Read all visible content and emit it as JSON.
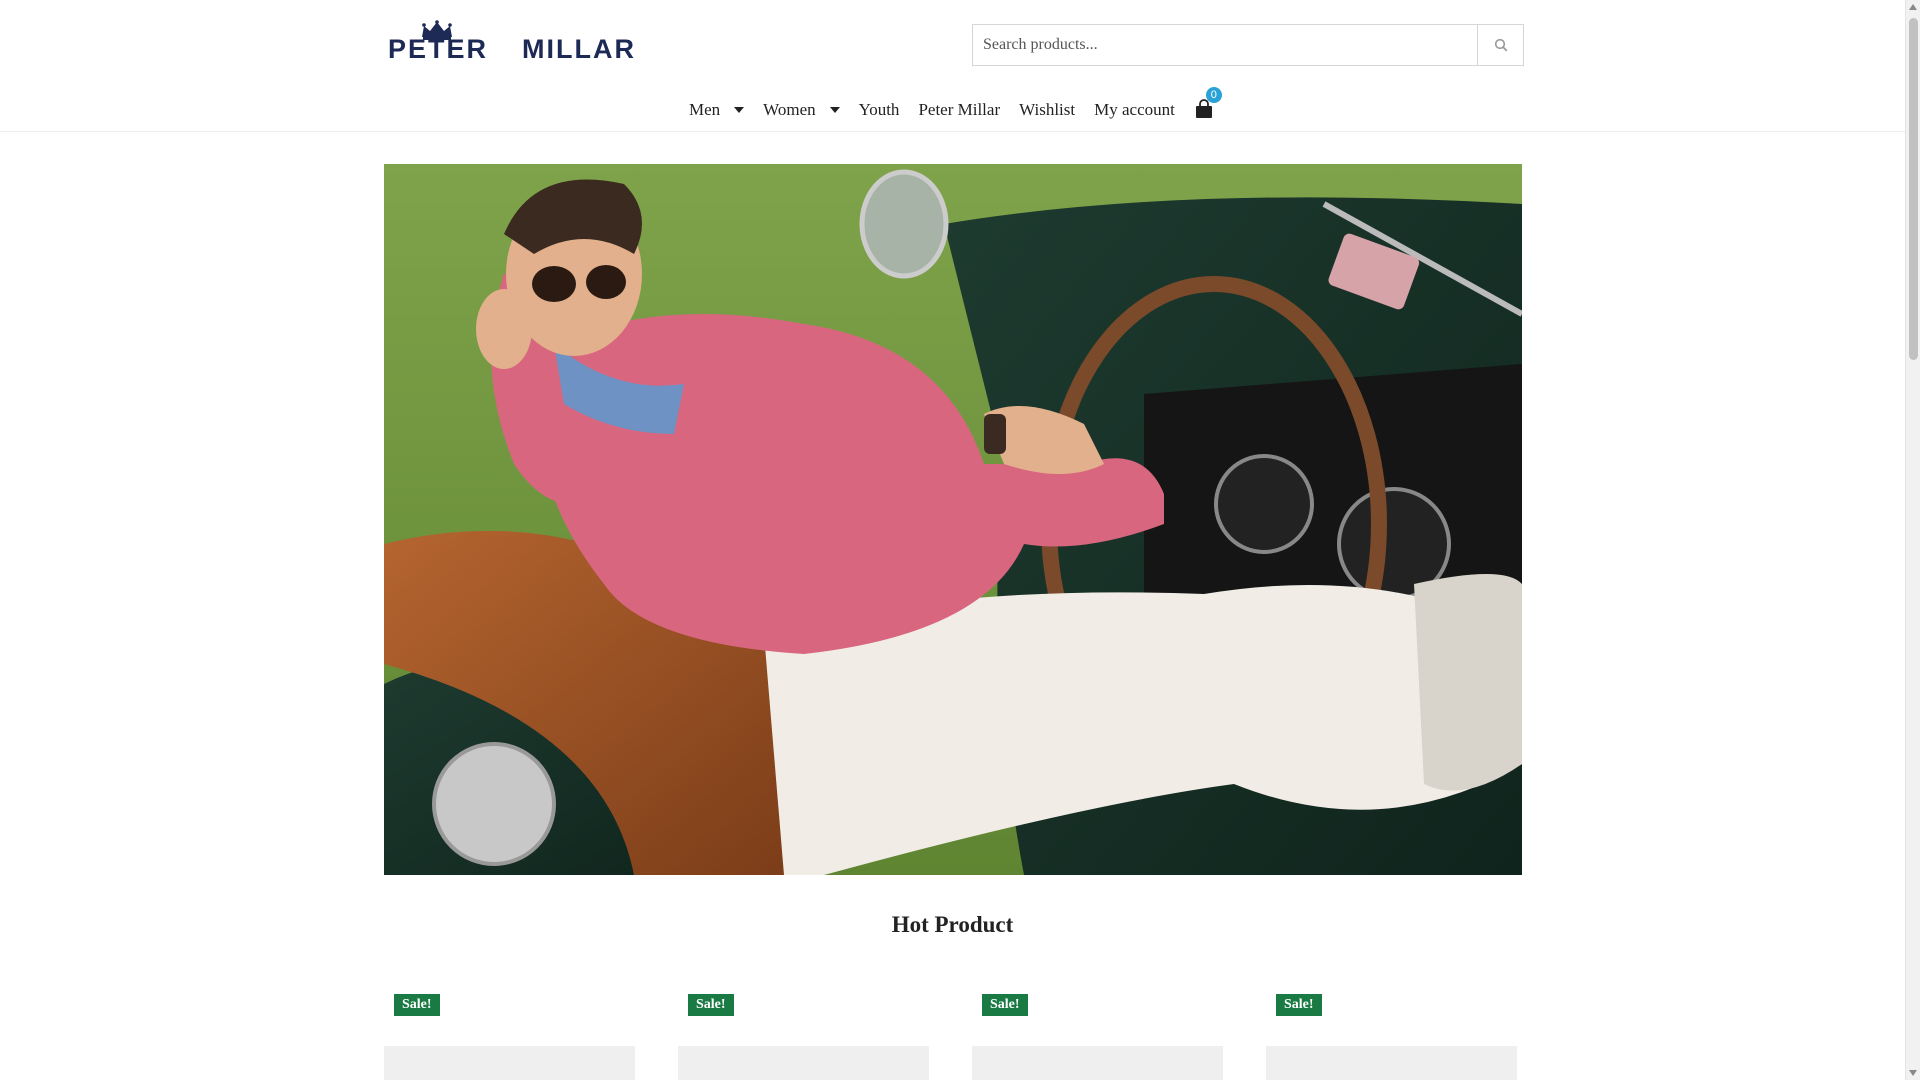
{
  "brand": {
    "name_left": "PETER",
    "name_right": "MILLAR",
    "logo_icon": "crown-icon"
  },
  "search": {
    "placeholder": "Search products...",
    "value": "",
    "icon": "search-icon"
  },
  "nav": {
    "items": [
      {
        "label": "Men",
        "has_dropdown": true
      },
      {
        "label": "Women",
        "has_dropdown": true
      },
      {
        "label": "Youth",
        "has_dropdown": false
      },
      {
        "label": "Peter Millar",
        "has_dropdown": false
      },
      {
        "label": "Wishlist",
        "has_dropdown": false
      },
      {
        "label": "My account",
        "has_dropdown": false
      }
    ],
    "cart": {
      "icon": "shopping-bag-icon",
      "count": "0"
    }
  },
  "hero": {
    "image": "hero-banner-image"
  },
  "section": {
    "title": "Hot Product"
  },
  "products": [
    {
      "badge": "Sale!"
    },
    {
      "badge": "Sale!"
    },
    {
      "badge": "Sale!"
    },
    {
      "badge": "Sale!"
    }
  ],
  "colors": {
    "sale_badge": "#1a7a43",
    "cart_count": "#2aa2d6",
    "brand_navy": "#1d2a55"
  }
}
